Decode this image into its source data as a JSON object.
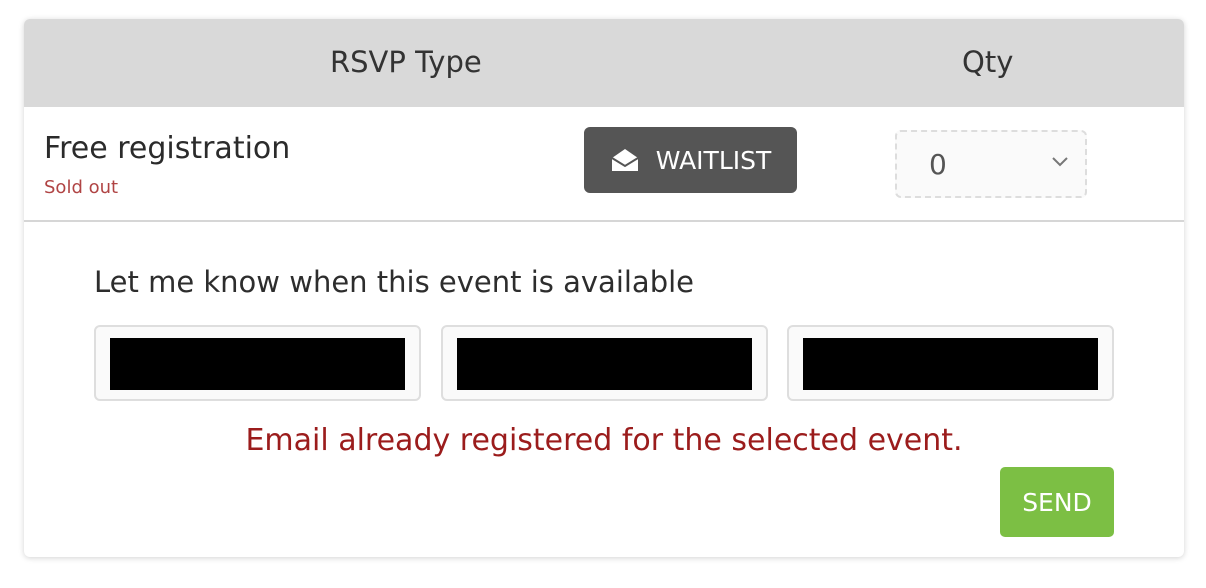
{
  "table": {
    "header_type": "RSVP Type",
    "header_qty": "Qty"
  },
  "rsvp": {
    "name": "Free registration",
    "status": "Sold out",
    "waitlist_label": "WAITLIST",
    "waitlist_icon": "envelope-open-icon",
    "qty_value": "0"
  },
  "notify": {
    "label": "Let me know when this event is available",
    "fields": [
      "",
      "",
      ""
    ],
    "error": "Email already registered for the selected event.",
    "send_label": "SEND"
  },
  "colors": {
    "header_bg": "#d9d9d9",
    "waitlist_bg": "#555555",
    "send_bg": "#7cbf44",
    "error": "#9b1c1c",
    "sold_out": "#b04444"
  }
}
